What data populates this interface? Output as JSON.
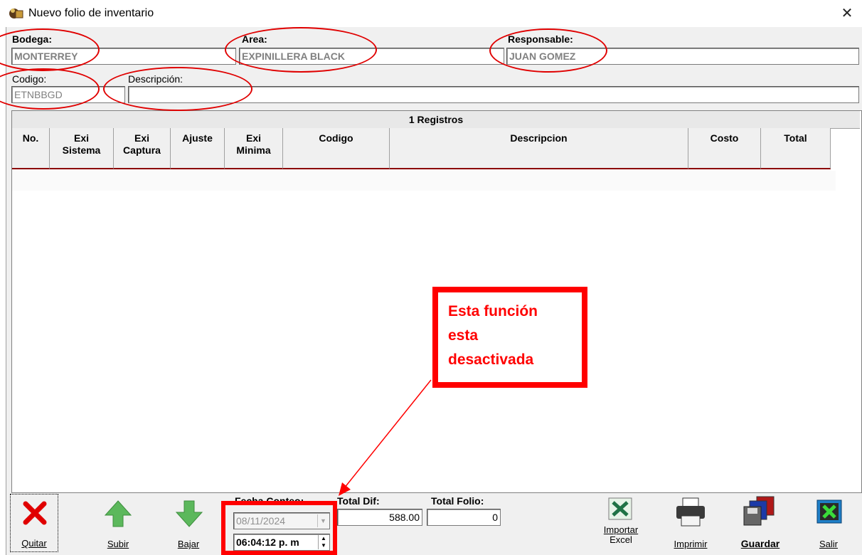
{
  "window": {
    "title": "Nuevo folio de inventario",
    "close_glyph": "✕",
    "icon": "app-icon"
  },
  "header": {
    "bodega_label": "Bodega:",
    "bodega_value": "MONTERREY",
    "area_label": "Area:",
    "area_value": "EXPINILLERA BLACK",
    "responsable_label": "Responsable:",
    "responsable_value": "JUAN GOMEZ",
    "codigo_label": "Codigo:",
    "codigo_value": "ETNBBGD",
    "descripcion_label": "Descripción:",
    "descripcion_value": ""
  },
  "grid": {
    "records_label": "1 Registros",
    "columns": [
      "No.",
      "Exi\nSistema",
      "Exi\nCaptura",
      "Ajuste",
      "Exi\nMinima",
      "Codigo",
      "Descripcion",
      "Costo",
      "Total"
    ]
  },
  "callout": {
    "text_line1": "Esta función",
    "text_line2": "esta",
    "text_line3": "desactivada",
    "color": "#ff0000"
  },
  "bottom": {
    "quitar": "Quitar",
    "subir": "Subir",
    "bajar": "Bajar",
    "fecha_conteo_label": "Fecha Conteo:",
    "fecha_value": "08/11/2024",
    "hora_value": "06:04:12 p. m",
    "total_dif_label": "Total Dif:",
    "total_dif_value": "588.00",
    "total_folio_label": "Total Folio:",
    "total_folio_value": "0",
    "importar_line1": "Importar",
    "importar_line2": "Excel",
    "imprimir": "Imprimir",
    "guardar": "Guardar",
    "salir": "Salir"
  },
  "colors": {
    "accent_red": "#ff0000",
    "grid_header_underline": "#8b0000"
  }
}
